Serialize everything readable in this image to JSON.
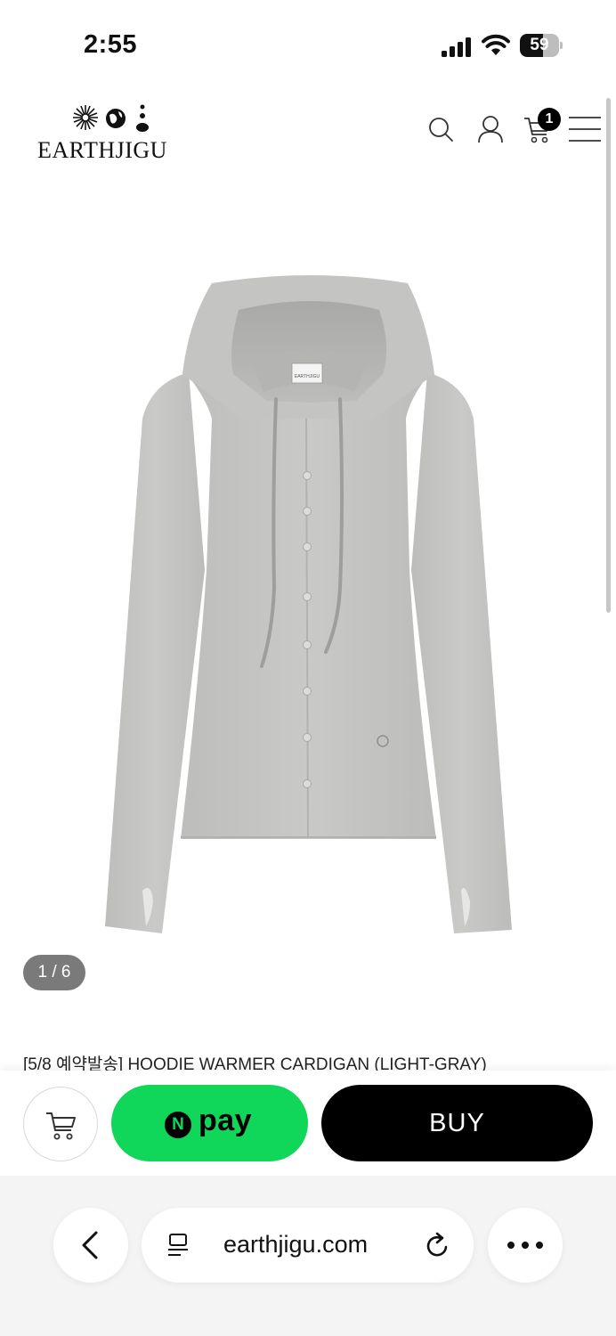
{
  "status_bar": {
    "time": "2:55",
    "battery": "59",
    "battery_level": 0.59
  },
  "header": {
    "brand": "EARTHJIGU",
    "cart_count": "1",
    "icons": [
      "search-icon",
      "user-icon",
      "cart-icon",
      "menu-icon"
    ]
  },
  "gallery": {
    "counter": "1 / 6",
    "logo_label": "EARTHJIGU"
  },
  "product": {
    "title": "[5/8 예약발송] HOODIE WARMER CARDIGAN (LIGHT-GRAY)"
  },
  "actions": {
    "npay_n": "N",
    "npay_label": "pay",
    "buy_label": "BUY"
  },
  "browser": {
    "url": "earthjigu.com"
  },
  "colors": {
    "npay_green": "#10d65a",
    "buy_black": "#000000",
    "garment_gray": "#c4c4c2"
  }
}
